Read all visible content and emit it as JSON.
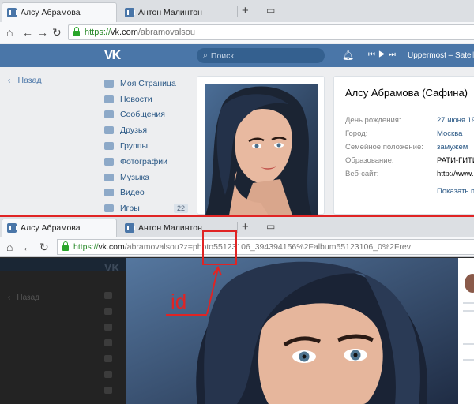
{
  "top_browser": {
    "tabs": [
      {
        "label": "Алсу Абрамова",
        "active": true
      },
      {
        "label": "Антон Малинтон",
        "active": false
      }
    ],
    "new_tab_icon": "+",
    "url_green": "https://",
    "url_host": "vk.com",
    "url_path": "/abramovalsou"
  },
  "vk_header": {
    "logo": "VK",
    "search_placeholder": "Поиск",
    "now_playing": "Uppermost – Satellite"
  },
  "left_nav": {
    "back_label": "Назад",
    "items": [
      {
        "label": "Моя Страница"
      },
      {
        "label": "Новости"
      },
      {
        "label": "Сообщения"
      },
      {
        "label": "Друзья"
      },
      {
        "label": "Группы"
      },
      {
        "label": "Фотографии"
      },
      {
        "label": "Музыка"
      },
      {
        "label": "Видео"
      },
      {
        "label": "Игры",
        "badge": "22"
      }
    ]
  },
  "profile": {
    "name": "Алсу Абрамова (Сафина)",
    "rows": [
      {
        "label": "День рождения:",
        "value": "27 июня 19"
      },
      {
        "label": "Город:",
        "value": "Москва"
      },
      {
        "label": "Семейное положение:",
        "value": "замужем"
      },
      {
        "label": "Образование:",
        "value": "РАТИ-ГИТИ"
      },
      {
        "label": "Веб-сайт:",
        "value": "http://www."
      }
    ],
    "show_more": "Показать п"
  },
  "bottom_browser": {
    "tabs": [
      {
        "label": "Алсу Абрамова",
        "active": true
      },
      {
        "label": "Антон Малинтон",
        "active": false
      }
    ],
    "url_green": "https://",
    "url_host": "vk.com",
    "url_path": "/abramovalsou?z=photo55123106_394394156%2Falbum55123106_0%2Frev",
    "dim_back": "Назад"
  },
  "annotation": {
    "label": "id",
    "color": "#e02424"
  },
  "colors": {
    "vk_blue": "#4a76a8",
    "link": "#2a5885",
    "annotation_red": "#e02424"
  }
}
